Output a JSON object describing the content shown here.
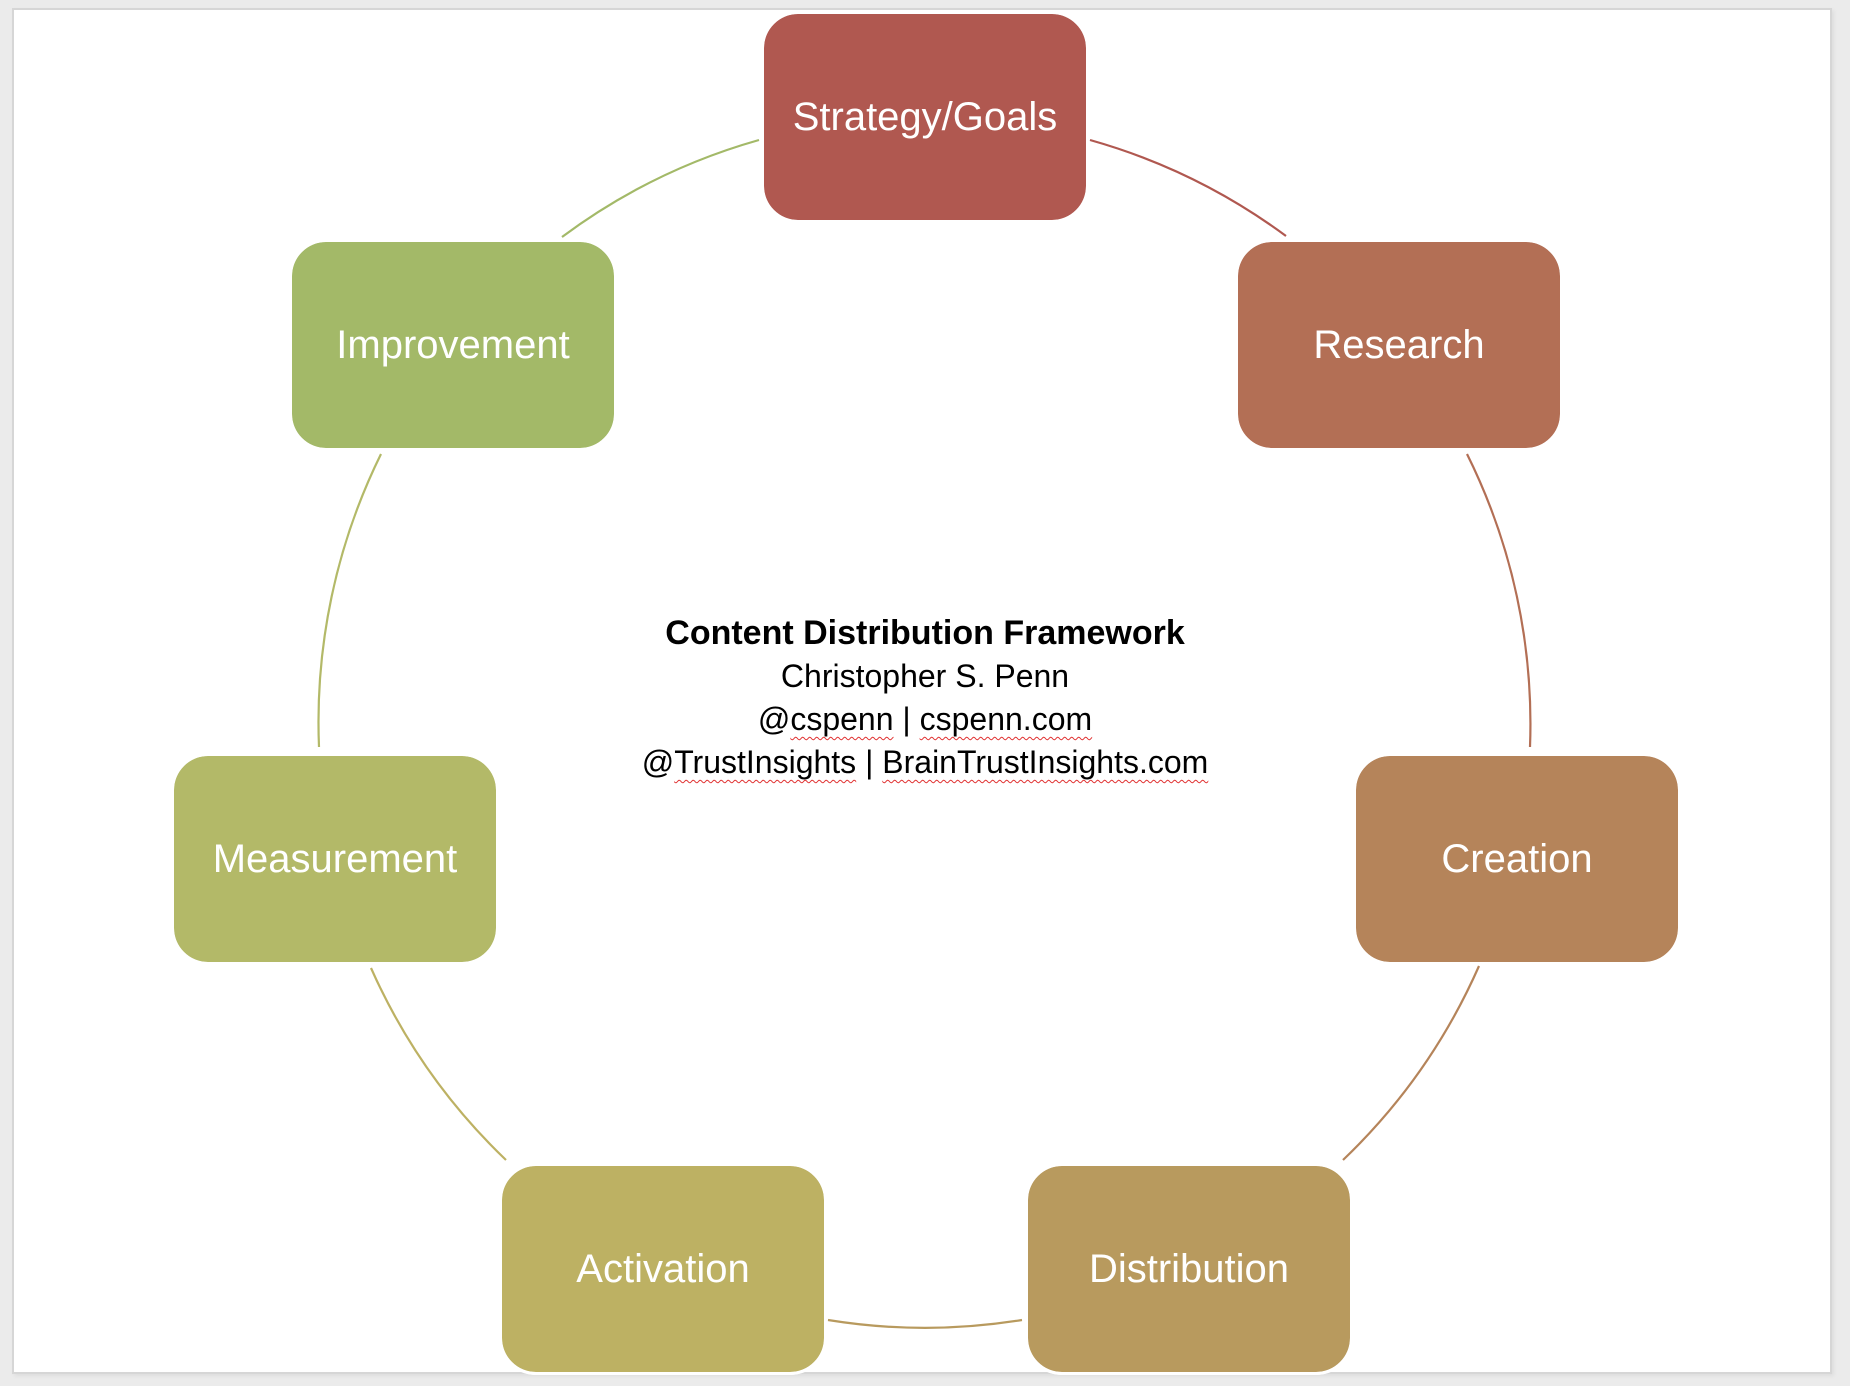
{
  "diagram": {
    "type": "cycle",
    "nodes": [
      {
        "label": "Strategy/Goals",
        "color": "#b05850"
      },
      {
        "label": "Research",
        "color": "#b36f55"
      },
      {
        "label": "Creation",
        "color": "#b5845a"
      },
      {
        "label": "Distribution",
        "color": "#b89a5e"
      },
      {
        "label": "Activation",
        "color": "#bdb163"
      },
      {
        "label": "Measurement",
        "color": "#b3b968"
      },
      {
        "label": "Improvement",
        "color": "#a3b968"
      }
    ],
    "connectors": [
      {
        "from": "Strategy/Goals",
        "to": "Research",
        "color": "#b05850"
      },
      {
        "from": "Research",
        "to": "Creation",
        "color": "#b36f55"
      },
      {
        "from": "Creation",
        "to": "Distribution",
        "color": "#b5845a"
      },
      {
        "from": "Distribution",
        "to": "Activation",
        "color": "#b89a5e"
      },
      {
        "from": "Activation",
        "to": "Measurement",
        "color": "#bdb163"
      },
      {
        "from": "Measurement",
        "to": "Improvement",
        "color": "#b3b968"
      },
      {
        "from": "Improvement",
        "to": "Strategy/Goals",
        "color": "#a3b968"
      }
    ]
  },
  "center": {
    "title": "Content Distribution Framework",
    "author": "Christopher S. Penn",
    "line3": {
      "handle": "@cspenn",
      "separator": " | ",
      "site": "cspenn.com"
    },
    "line4": {
      "handle": "@TrustInsights",
      "separator": " | ",
      "site": "BrainTrustInsights.com"
    }
  },
  "colors": {
    "slide_background": "#ffffff",
    "page_background": "#ebebeb",
    "spellcheck_underline": "#e03030"
  }
}
